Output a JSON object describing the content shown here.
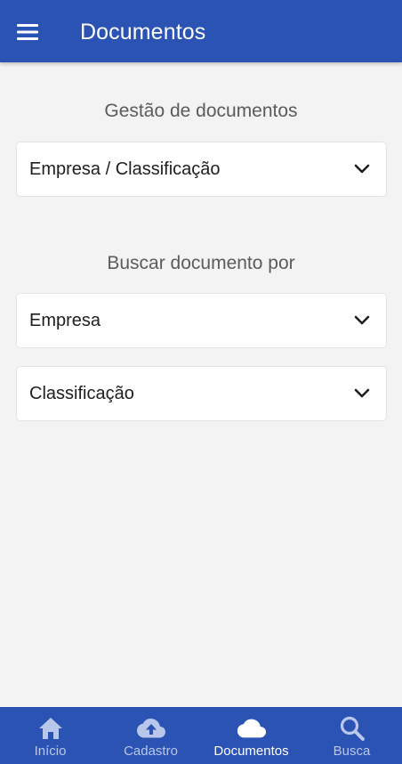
{
  "app_bar": {
    "title": "Documentos",
    "menu_icon": "menu-icon"
  },
  "management": {
    "heading": "Gestão de documentos",
    "select_label": "Empresa / Classificação"
  },
  "search": {
    "heading": "Buscar documento por",
    "company_label": "Empresa",
    "classification_label": "Classificação"
  },
  "bottom_nav": {
    "items": [
      {
        "label": "Início",
        "icon": "home-icon",
        "active": false
      },
      {
        "label": "Cadastro",
        "icon": "cloud-upload-icon",
        "active": false
      },
      {
        "label": "Documentos",
        "icon": "cloud-icon",
        "active": true
      },
      {
        "label": "Busca",
        "icon": "search-icon",
        "active": false
      }
    ]
  },
  "colors": {
    "primary": "#2a53b4",
    "background": "#f3f3f4",
    "card": "#ffffff",
    "nav_inactive": "#b8c7ea",
    "nav_active": "#ffffff"
  }
}
